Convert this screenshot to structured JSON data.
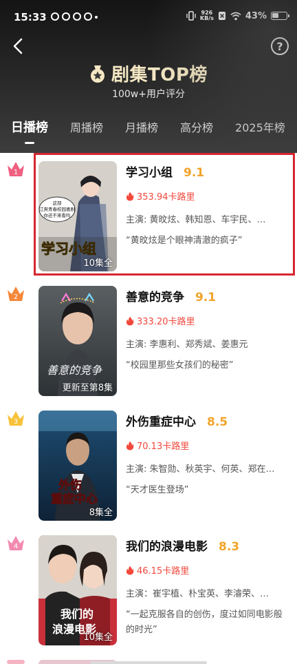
{
  "status_bar": {
    "time": "15:33",
    "net_speed_value": "926",
    "net_speed_unit": "KB/s",
    "battery_percent": "43%"
  },
  "header": {
    "title": "剧集TOP榜",
    "subtitle": "100w+用户评分",
    "help_symbol": "?"
  },
  "tabs": [
    {
      "label": "日播榜",
      "active": true
    },
    {
      "label": "周播榜",
      "active": false
    },
    {
      "label": "月播榜",
      "active": false
    },
    {
      "label": "高分榜",
      "active": false
    },
    {
      "label": "2025年榜",
      "active": false
    }
  ],
  "rankings": [
    {
      "rank": "1",
      "title": "学习小组",
      "score": "9.1",
      "heat": "353.94卡路里",
      "cast": "主演: 黄旼炫、韩知恩、车宇民、…",
      "quote": "“黄旼炫是个眼神清澈的疯子”",
      "poster_caption": "10集全",
      "poster_text": "学习小组",
      "poster_bubble": "这部\n江爽青春校园喜剧\n你还不来看吗",
      "crown_color": "#ef5f80"
    },
    {
      "rank": "2",
      "title": "善意的竞争",
      "score": "9.1",
      "heat": "333.20卡路里",
      "cast": "主演: 李惠利、郑秀斌、姜惠元",
      "quote": "“校园里那些女孩们的秘密”",
      "poster_caption": "更新至第8集",
      "poster_text": "善意的竞争",
      "crown_color": "#f5883a"
    },
    {
      "rank": "3",
      "title": "外伤重症中心",
      "score": "8.5",
      "heat": "70.13卡路里",
      "cast": "主演: 朱智勋、秋英宇、何英、郑在…",
      "quote": "“天才医生登场”",
      "poster_caption": "8集全",
      "poster_text_line1": "外伤",
      "poster_text_line2": "重症中心",
      "crown_color": "#f7c23a"
    },
    {
      "rank": "4",
      "title": "我们的浪漫电影",
      "score": "8.3",
      "heat": "46.15卡路里",
      "cast": "主演：崔宇植、朴宝英、李濬荣、…",
      "quote": "“一起克服各自的创伤，度过如同电影般的时光”",
      "poster_caption": "10集全",
      "poster_text_line1": "我们的",
      "poster_text_line2": "浪漫电影",
      "crown_color": "#f28ab0"
    }
  ]
}
